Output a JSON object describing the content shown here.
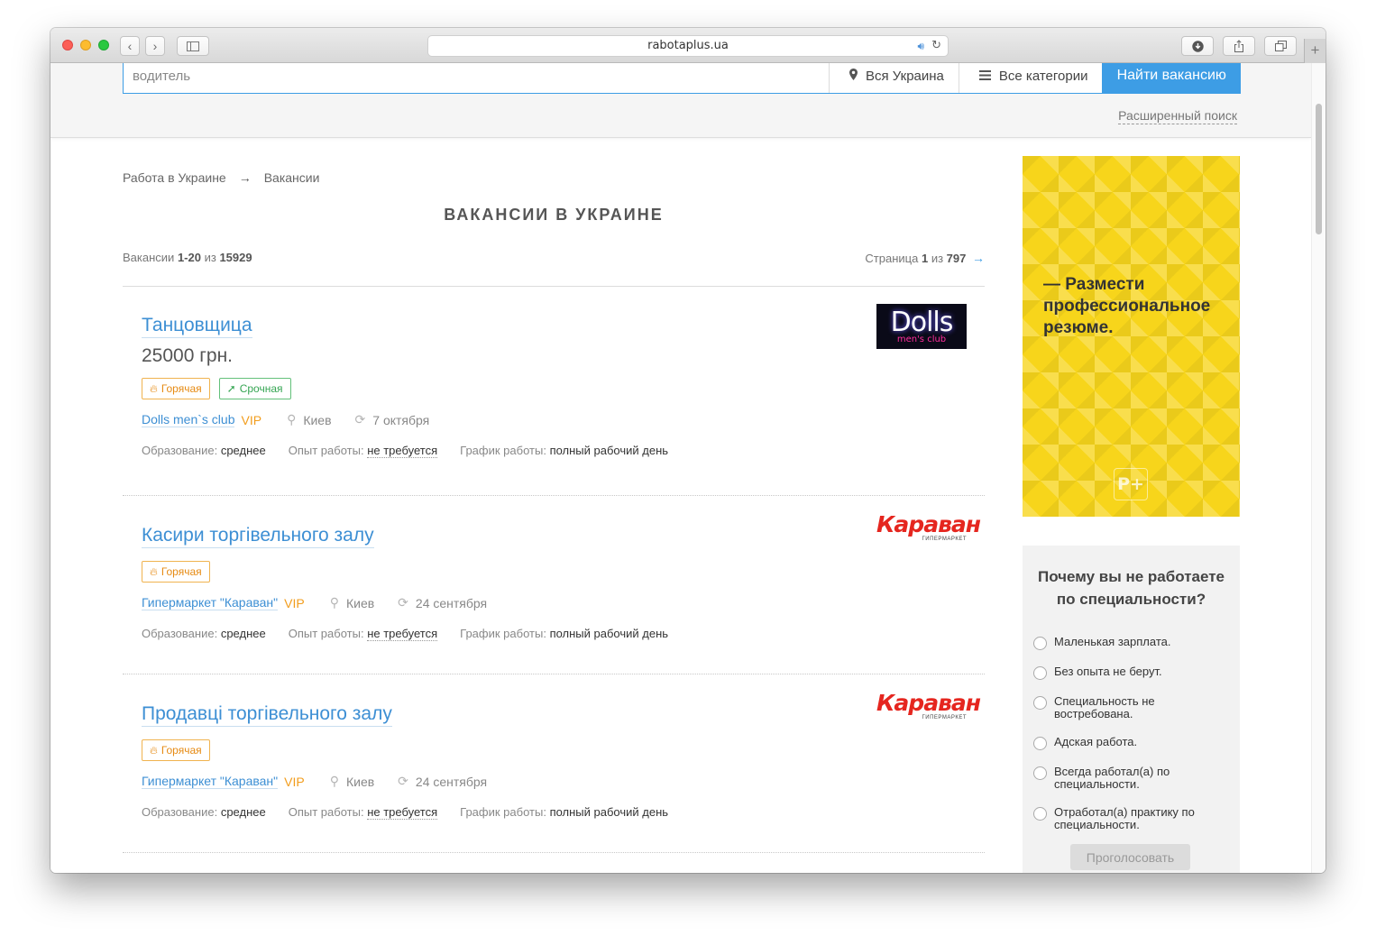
{
  "browser": {
    "url": "rabotaplus.ua",
    "back_icon": "chevron-left",
    "forward_icon": "chevron-right",
    "new_tab_label": "+"
  },
  "search": {
    "query_value": "водитель",
    "location": "Вся Украина",
    "category": "Все категории",
    "submit_label": "Найти вакансию",
    "advanced_label": "Расширенный поиск"
  },
  "breadcrumb": [
    "Работа в Украине",
    "Вакансии"
  ],
  "breadcrumb_separator": "→",
  "page_title": "ВАКАНСИИ В УКРАИНЕ",
  "counts": {
    "prefix": "Вакансии",
    "range": "1-20",
    "of": "из",
    "total": "15929"
  },
  "pager": {
    "prefix": "Страница",
    "current": "1",
    "of": "из",
    "total": "797",
    "next": "→"
  },
  "labels": {
    "education": "Образование:",
    "experience": "Опыт работы:",
    "schedule": "График работы:",
    "hot": "Горячая",
    "urgent": "Срочная",
    "vip": "VIP"
  },
  "jobs": [
    {
      "title": "Танцовщица",
      "salary": "25000 грн.",
      "company": "Dolls men`s club",
      "city": "Киев",
      "date": "7 октября",
      "education": "среднее",
      "experience": "не требуется",
      "schedule": "полный рабочий день",
      "logo_main": "Dolls",
      "logo_sub": "men's club"
    },
    {
      "title": "Касири торгівельного залу",
      "company": "Гипермаркет \"Караван\"",
      "city": "Киев",
      "date": "24 сентября",
      "education": "среднее",
      "experience": "не требуется",
      "schedule": "полный рабочий день",
      "logo_main": "Караван",
      "logo_sub": "ГИПЕРМАРКЕТ"
    },
    {
      "title": "Продавці торгівельного залу",
      "company": "Гипермаркет \"Караван\"",
      "city": "Киев",
      "date": "24 сентября",
      "education": "среднее",
      "experience": "не требуется",
      "schedule": "полный рабочий день",
      "logo_main": "Караван",
      "logo_sub": "ГИПЕРМАРКЕТ"
    }
  ],
  "ad": {
    "text": "— Размести профессиональное резюме.",
    "logo": "P+"
  },
  "poll": {
    "question": "Почему вы не работаете по специальности?",
    "options": [
      "Маленькая зарплата.",
      "Без опыта не берут.",
      "Специальность не востребована.",
      "Адская работа.",
      "Всегда работал(а) по специальности.",
      "Отработал(а) практику по специальности."
    ],
    "vote_label": "Проголосовать"
  },
  "colors": {
    "accent": "#3d9de5",
    "link": "#3d8fd4",
    "vip": "#f29d1d",
    "hot": "#e68a12",
    "urgent": "#35a552",
    "banner": "#f7d51b"
  }
}
